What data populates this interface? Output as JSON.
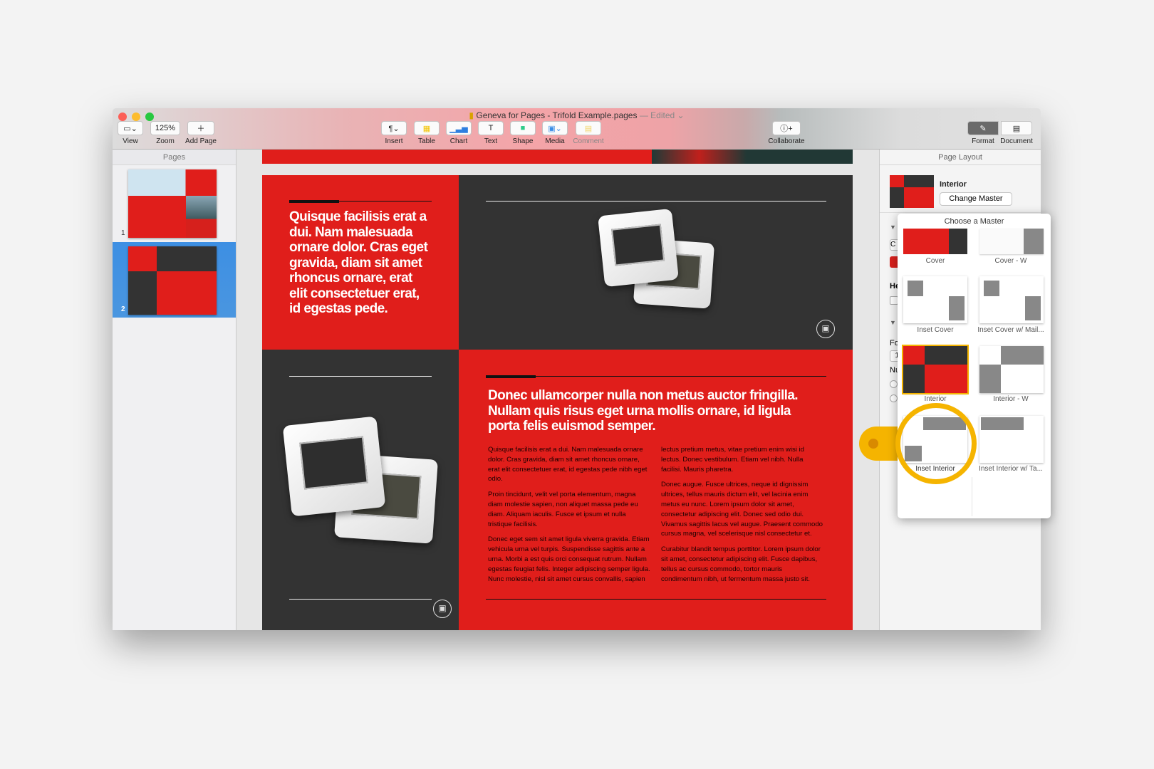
{
  "window": {
    "title": "Geneva for Pages - Trifold Example.pages",
    "status": "— Edited"
  },
  "toolbar": {
    "view": "View",
    "zoom_value": "125%",
    "zoom": "Zoom",
    "add_page": "Add Page",
    "insert": "Insert",
    "table": "Table",
    "chart": "Chart",
    "text": "Text",
    "shape": "Shape",
    "media": "Media",
    "comment": "Comment",
    "collaborate": "Collaborate",
    "format": "Format",
    "document": "Document"
  },
  "pages": {
    "header": "Pages",
    "items": [
      {
        "number": "1"
      },
      {
        "number": "2",
        "selected": true
      }
    ]
  },
  "document": {
    "headline1": "Quisque facilisis erat a dui. Nam malesuada ornare dolor. Cras eget gravida, diam sit amet rhoncus ornare, erat elit consectetuer erat, id egestas pede.",
    "headline2": "Donec ullamcorper nulla non metus auctor fringilla. Nullam quis risus eget urna mollis ornare, id ligula porta felis euismod semper.",
    "col1": [
      "Quisque facilisis erat a dui. Nam malesuada ornare dolor. Cras gravida, diam sit amet rhoncus ornare, erat elit consectetuer erat, id egestas pede nibh eget odio.",
      "Proin tincidunt, velit vel porta elementum, magna diam molestie sapien, non aliquet massa pede eu diam. Aliquam iaculis. Fusce et ipsum et nulla tristique facilisis.",
      "Donec eget sem sit amet ligula viverra gravida. Etiam vehicula urna vel turpis. Suspendisse sagittis ante a urna. Morbi a est quis orci consequat rutrum. Nullam egestas feugiat felis. Integer adipiscing semper ligula. Nunc molestie, nisl sit amet cursus convallis, sapien"
    ],
    "col2": [
      "lectus pretium metus, vitae pretium enim wisi id lectus. Donec vestibulum. Etiam vel nibh. Nulla facilisi. Mauris pharetra.",
      "Donec augue. Fusce ultrices, neque id dignissim ultrices, tellus mauris dictum elit, vel lacinia enim metus eu nunc. Lorem ipsum dolor sit amet, consectetur adipiscing elit. Donec sed odio dui. Vivamus sagittis lacus vel augue. Praesent commodo cursus magna, vel scelerisque nisl consectetur et.",
      "Curabitur blandit tempus porttitor. Lorem ipsum dolor sit amet, consectetur adipiscing elit. Fusce dapibus, tellus ac cursus commodo, tortor mauris condimentum nibh, ut fermentum massa justo sit."
    ]
  },
  "inspector": {
    "header": "Page Layout",
    "master_name": "Interior",
    "change_master": "Change Master",
    "partial_labels": [
      "C",
      "He",
      "Fo",
      "1",
      "Nu"
    ]
  },
  "popover": {
    "title": "Choose a Master",
    "masters": [
      {
        "label": "Cover"
      },
      {
        "label": "Cover - W"
      },
      {
        "label": "Inset Cover"
      },
      {
        "label": "Inset Cover w/ Mail..."
      },
      {
        "label": "Interior",
        "selected": true
      },
      {
        "label": "Interior - W"
      },
      {
        "label": "Inset Interior",
        "highlighted": true
      },
      {
        "label": "Inset Interior w/ Ta..."
      }
    ]
  },
  "colors": {
    "accent_red": "#e01e1b",
    "dark": "#333333",
    "highlight": "#f5b400",
    "selection": "#3b8fe0"
  }
}
